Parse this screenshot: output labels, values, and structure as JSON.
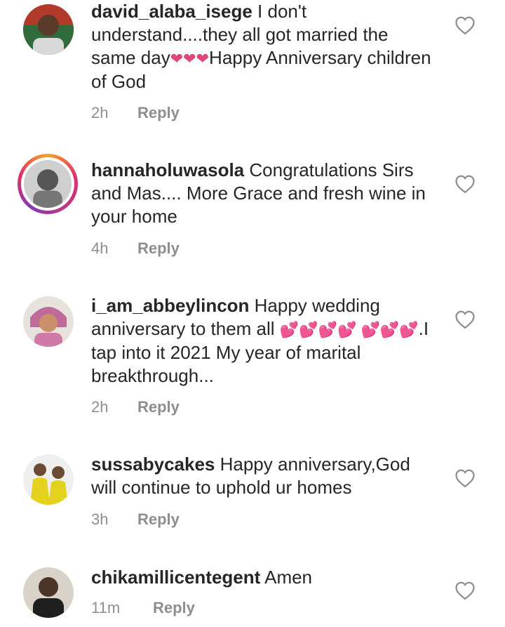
{
  "comments": [
    {
      "username": "david_alaba_isege",
      "text_before": " I don't understand....they all got married the same day",
      "emoji": "❤❤❤",
      "text_after": "Happy Anniversary children of God",
      "time": "2h",
      "reply": "Reply"
    },
    {
      "username": "hannaholuwasola",
      "text_before": " Congratulations Sirs and Mas.... More Grace and fresh wine in your home",
      "emoji": "",
      "text_after": "",
      "time": "4h",
      "reply": "Reply"
    },
    {
      "username": "i_am_abbeylincon",
      "text_before": " Happy wedding anniversary to them all ",
      "emoji": "💕💕💕💕 💕💕💕",
      "text_after": ".I tap into it 2021 My year of marital breakthrough...",
      "time": "2h",
      "reply": "Reply"
    },
    {
      "username": "sussabycakes",
      "text_before": " Happy anniversary,God will continue to uphold ur homes",
      "emoji": "",
      "text_after": "",
      "time": "3h",
      "reply": "Reply"
    },
    {
      "username": "chikamillicentegent",
      "text_before": " Amen",
      "emoji": "",
      "text_after": "",
      "time": "11m",
      "reply": "Reply"
    }
  ],
  "icons": {
    "like": "heart-outline-icon"
  },
  "colors": {
    "text": "#262626",
    "muted": "#8e8e8e",
    "emoji": "#e0457b"
  }
}
